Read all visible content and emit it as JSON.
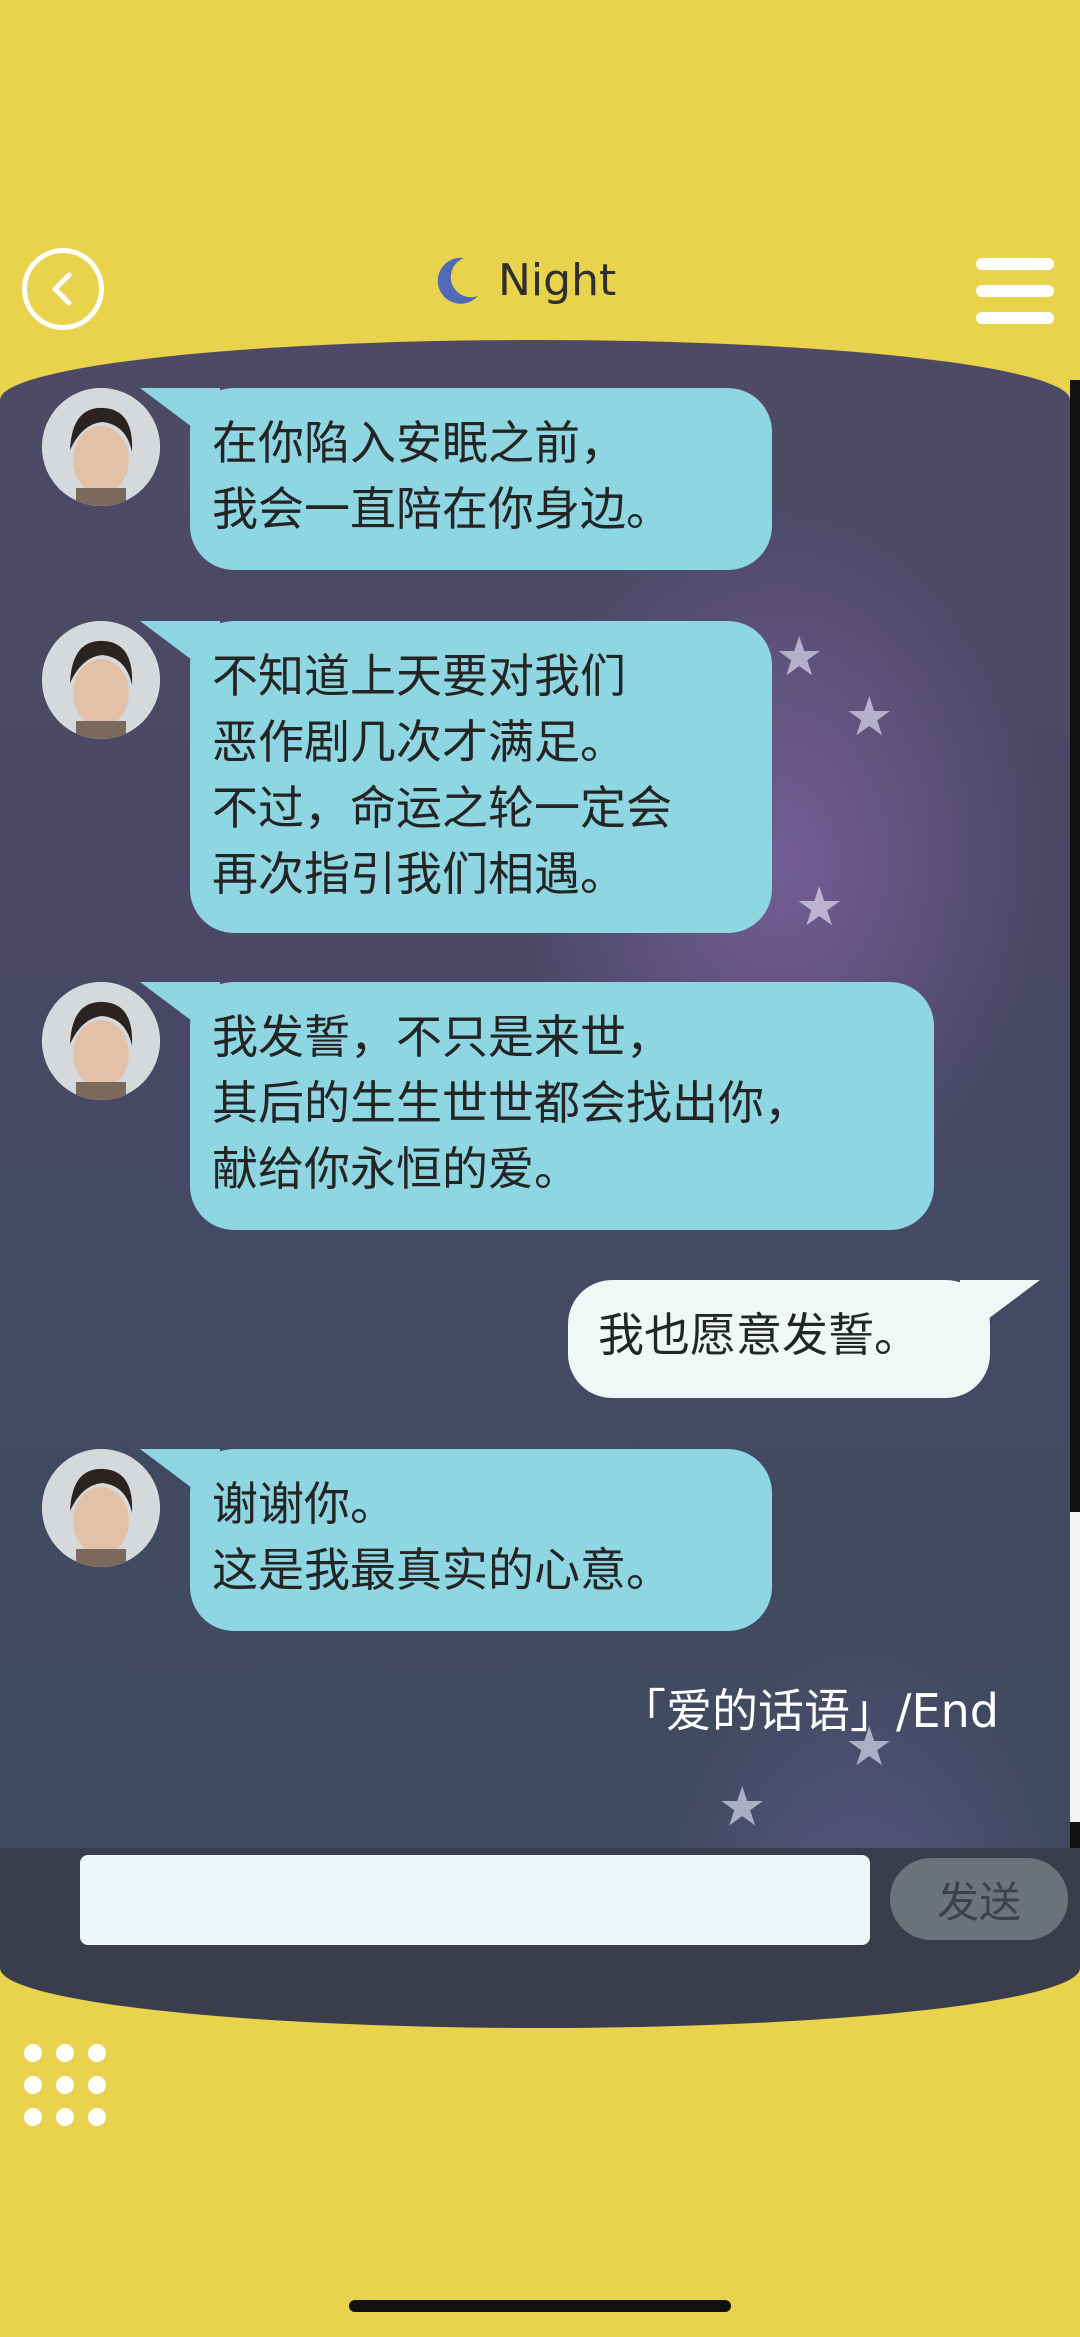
{
  "header": {
    "title": "Night",
    "icons": [
      "back-arrow-icon",
      "crescent-moon-icon",
      "menu-icon"
    ],
    "accent_color": "#e9d34c",
    "moon_color": "#4f6bb8"
  },
  "messages": [
    {
      "side": "left",
      "lines": [
        "在你陷入安眠之前，",
        "我会一直陪在你身边。"
      ]
    },
    {
      "side": "left",
      "lines": [
        "不知道上天要对我们",
        "恶作剧几次才满足。",
        "不过，命运之轮一定会",
        "再次指引我们相遇。"
      ]
    },
    {
      "side": "left",
      "lines": [
        "我发誓，不只是来世，",
        "其后的生生世世都会找出你，",
        "献给你永恒的爱。"
      ]
    },
    {
      "side": "right",
      "lines": [
        "我也愿意发誓。"
      ]
    },
    {
      "side": "left",
      "lines": [
        "谢谢你。",
        "这是我最真实的心意。"
      ]
    }
  ],
  "end_label": "「爱的话语」/End",
  "composer": {
    "input_value": "",
    "send_label": "发送"
  },
  "bottom": {
    "icons": [
      "grid-menu-icon"
    ]
  }
}
